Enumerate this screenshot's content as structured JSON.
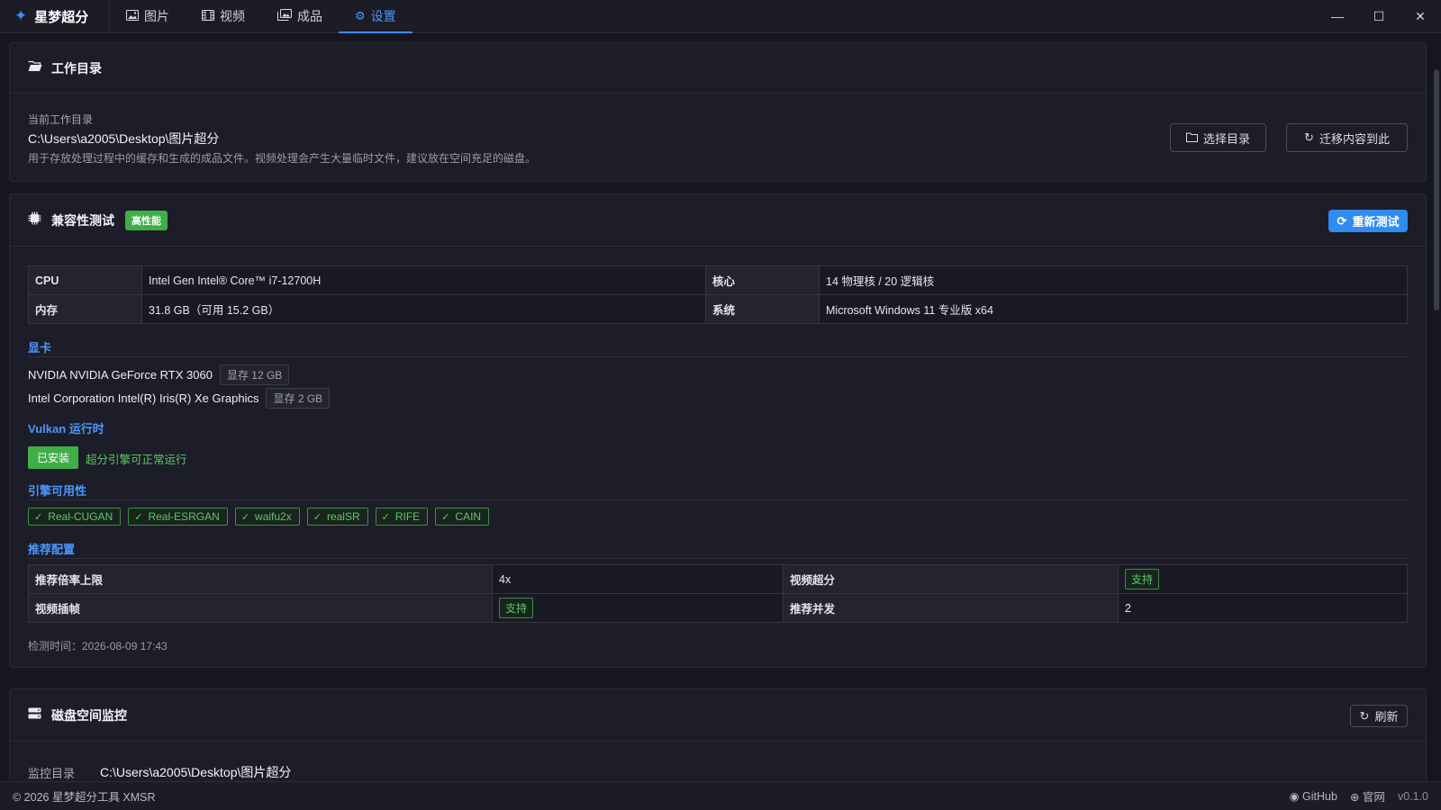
{
  "app": {
    "title": "星梦超分"
  },
  "tabs": [
    {
      "label": "图片",
      "icon": "image-icon"
    },
    {
      "label": "视频",
      "icon": "film-icon"
    },
    {
      "label": "成品",
      "icon": "gallery-icon"
    },
    {
      "label": "设置",
      "icon": "gear-icon",
      "active": true
    }
  ],
  "window_controls": {
    "minimize": "—",
    "maximize": "☐",
    "close": "✕"
  },
  "workdir": {
    "title": "工作目录",
    "label": "当前工作目录",
    "path": "C:\\Users\\a2005\\Desktop\\图片超分",
    "description": "用于存放处理过程中的缓存和生成的成品文件。视频处理会产生大量临时文件，建议放在空间充足的磁盘。",
    "choose_btn": "选择目录",
    "migrate_btn": "迁移内容到此"
  },
  "compat": {
    "title": "兼容性测试",
    "badge": "高性能",
    "retest_btn": "重新测试",
    "system_info": [
      [
        "CPU",
        "Intel Gen Intel® Core™ i7-12700H",
        "核心",
        "14 物理核 / 20 逻辑核"
      ],
      [
        "内存",
        "31.8 GB（可用 15.2 GB）",
        "系统",
        "Microsoft Windows 11 专业版 x64"
      ]
    ],
    "gpu_title": "显卡",
    "gpus": [
      {
        "name": "NVIDIA NVIDIA GeForce RTX 3060",
        "vram": "显存 12 GB"
      },
      {
        "name": "Intel Corporation Intel(R) Iris(R) Xe Graphics",
        "vram": "显存 2 GB"
      }
    ],
    "vulkan_title": "Vulkan 运行时",
    "vulkan_status": "已安装",
    "vulkan_note": "超分引擎可正常运行",
    "engines_title": "引擎可用性",
    "engines": [
      "Real-CUGAN",
      "Real-ESRGAN",
      "waifu2x",
      "realSR",
      "RIFE",
      "CAIN"
    ],
    "recommend_title": "推荐配置",
    "recommend": {
      "max_scale_label": "推荐倍率上限",
      "max_scale": "4x",
      "video_sr_label": "视频超分",
      "video_sr": "支持",
      "frame_interp_label": "视频插帧",
      "frame_interp": "支持",
      "concurrency_label": "推荐并发",
      "concurrency": "2"
    },
    "detect_time": "检测时间：2026-08-09 17:43"
  },
  "disk": {
    "title": "磁盘空间监控",
    "refresh_btn": "刷新",
    "monitor_label": "监控目录",
    "monitor_path": "C:\\Users\\a2005\\Desktop\\图片超分"
  },
  "footer": {
    "copyright": "© 2026 星梦超分工具 XMSR",
    "github": "GitHub",
    "website": "官网",
    "version": "v0.1.0"
  },
  "colors": {
    "accent": "#3d8bff",
    "success": "#3fae47",
    "background": "#15161f"
  }
}
